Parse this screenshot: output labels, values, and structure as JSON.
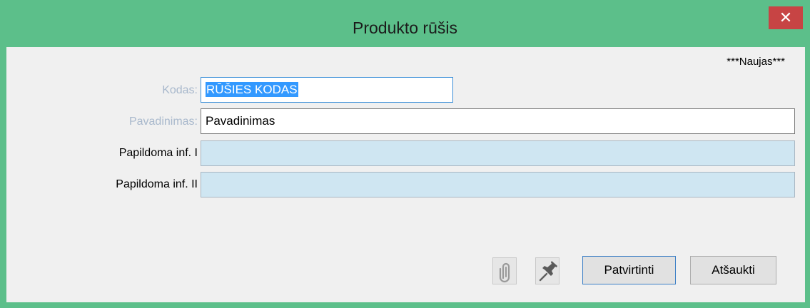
{
  "window": {
    "title": "Produkto rūšis",
    "close_glyph": "✕"
  },
  "status": "***Naujas***",
  "form": {
    "kodas": {
      "label": "Kodas:",
      "value": "RŪŠIES KODAS"
    },
    "pavadinimas": {
      "label": "Pavadinimas:",
      "value": "Pavadinimas"
    },
    "papildoma1": {
      "label": "Papildoma inf. I",
      "value": ""
    },
    "papildoma2": {
      "label": "Papildoma inf. II",
      "value": ""
    }
  },
  "buttons": {
    "attach_icon": "paperclip-icon",
    "pin_icon": "pushpin-icon",
    "confirm": "Patvirtinti",
    "cancel": "Atšaukti"
  },
  "colors": {
    "frame": "#5cbf8a",
    "close": "#c74444",
    "selection": "#3399ff",
    "readonly_field": "#cfe6f2"
  }
}
